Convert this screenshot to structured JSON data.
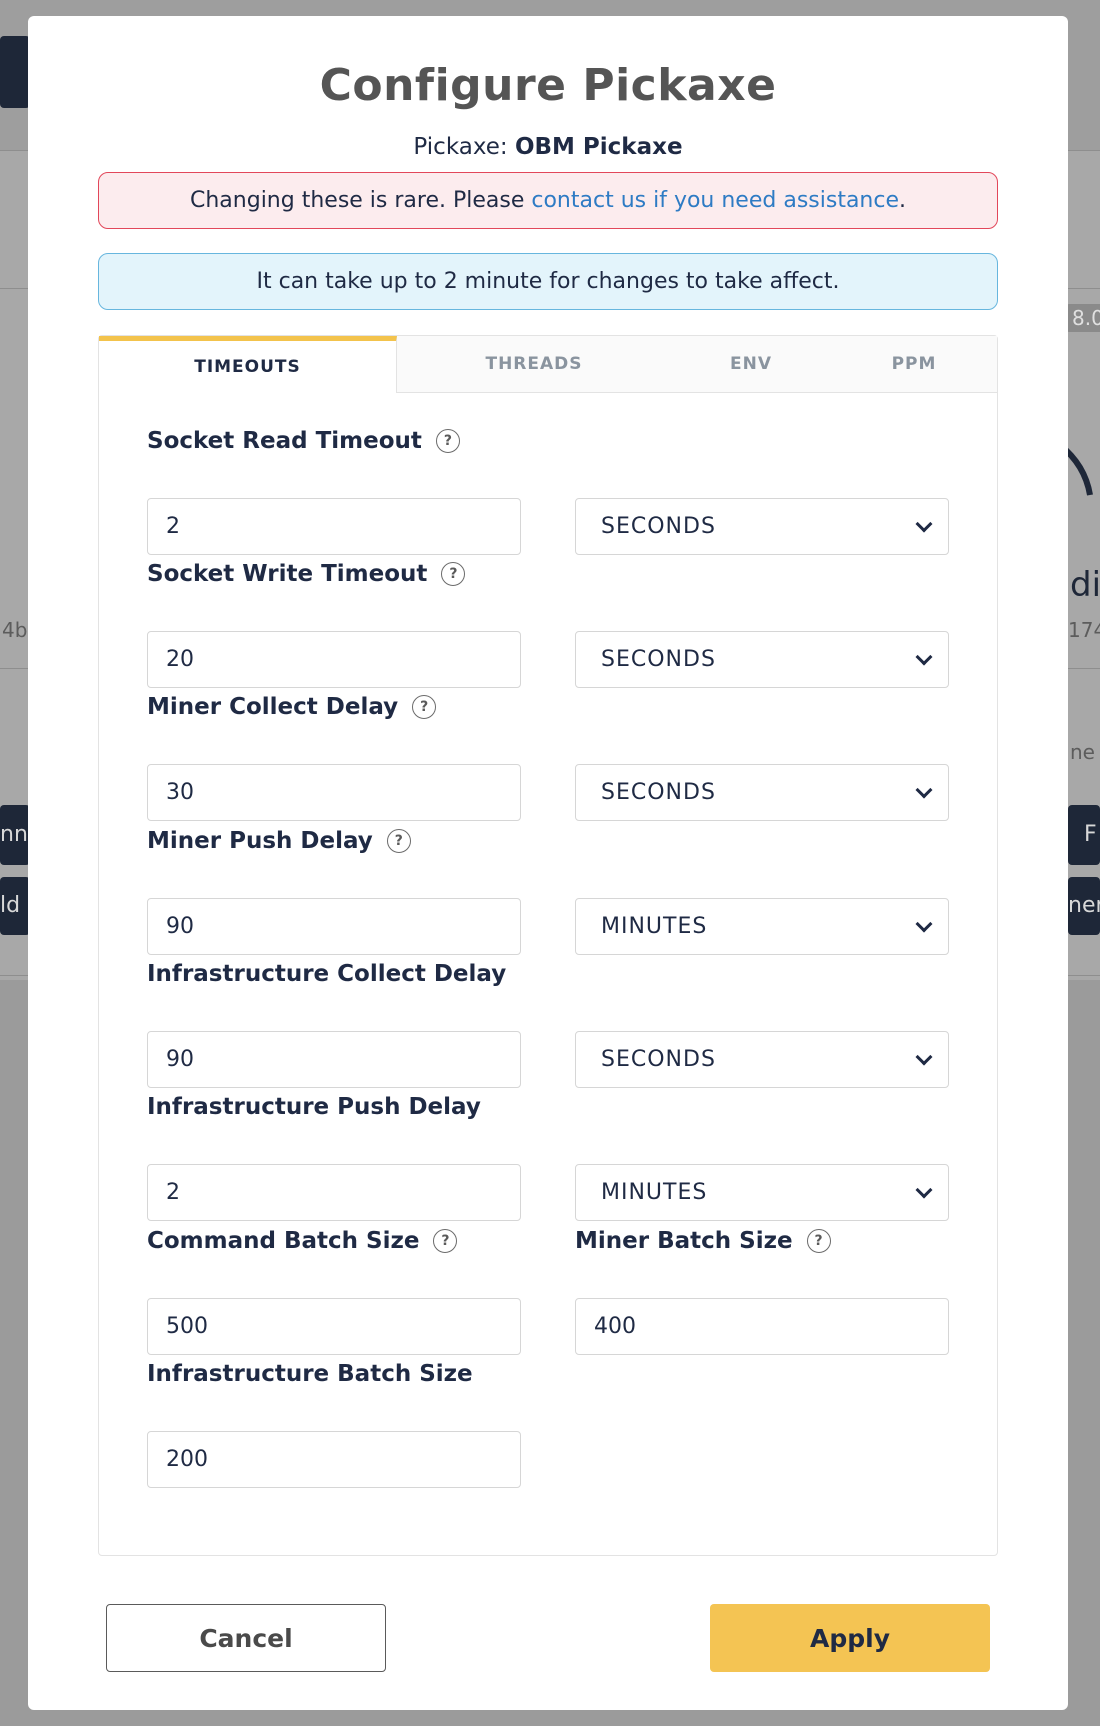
{
  "modal": {
    "title": "Configure Pickaxe",
    "subtitle_prefix": "Pickaxe: ",
    "subtitle_name": "OBM Pickaxe"
  },
  "alerts": {
    "danger_text": "Changing these is rare. Please ",
    "danger_link": "contact us if you need assistance",
    "danger_suffix": ".",
    "info_text": "It can take up to 2 minute for changes to take affect."
  },
  "tabs": [
    {
      "label": "TIMEOUTS"
    },
    {
      "label": "THREADS"
    },
    {
      "label": "ENV"
    },
    {
      "label": "PPM"
    }
  ],
  "fields": {
    "socket_read": {
      "label": "Socket Read Timeout",
      "value": "2",
      "unit": "SECONDS"
    },
    "socket_write": {
      "label": "Socket Write Timeout",
      "value": "20",
      "unit": "SECONDS"
    },
    "miner_collect": {
      "label": "Miner Collect Delay",
      "value": "30",
      "unit": "SECONDS"
    },
    "miner_push": {
      "label": "Miner Push Delay",
      "value": "90",
      "unit": "MINUTES"
    },
    "infra_collect": {
      "label": "Infrastructure Collect Delay",
      "value": "90",
      "unit": "SECONDS"
    },
    "infra_push": {
      "label": "Infrastructure Push Delay",
      "value": "2",
      "unit": "MINUTES"
    },
    "command_batch": {
      "label": "Command Batch Size",
      "value": "500"
    },
    "miner_batch": {
      "label": "Miner Batch Size",
      "value": "400"
    },
    "infra_batch": {
      "label": "Infrastructure Batch Size",
      "value": "200"
    }
  },
  "help_glyph": "?",
  "buttons": {
    "cancel": "Cancel",
    "apply": "Apply"
  },
  "background": {
    "badge": "8.0",
    "text_left_1": "4b",
    "text_right_1": "di",
    "text_right_2": "174-",
    "text_right_3": "ne",
    "text_left_2": "nn",
    "text_right_4": "F",
    "text_left_3": "ld",
    "text_right_5": "ner"
  },
  "colors": {
    "accent": "#f4c453",
    "tab_indicator": "#f3c34c",
    "link": "#2e7bc4",
    "danger_border": "#e2475a",
    "info_border": "#67b6de",
    "text_dark": "#1f2a44"
  }
}
